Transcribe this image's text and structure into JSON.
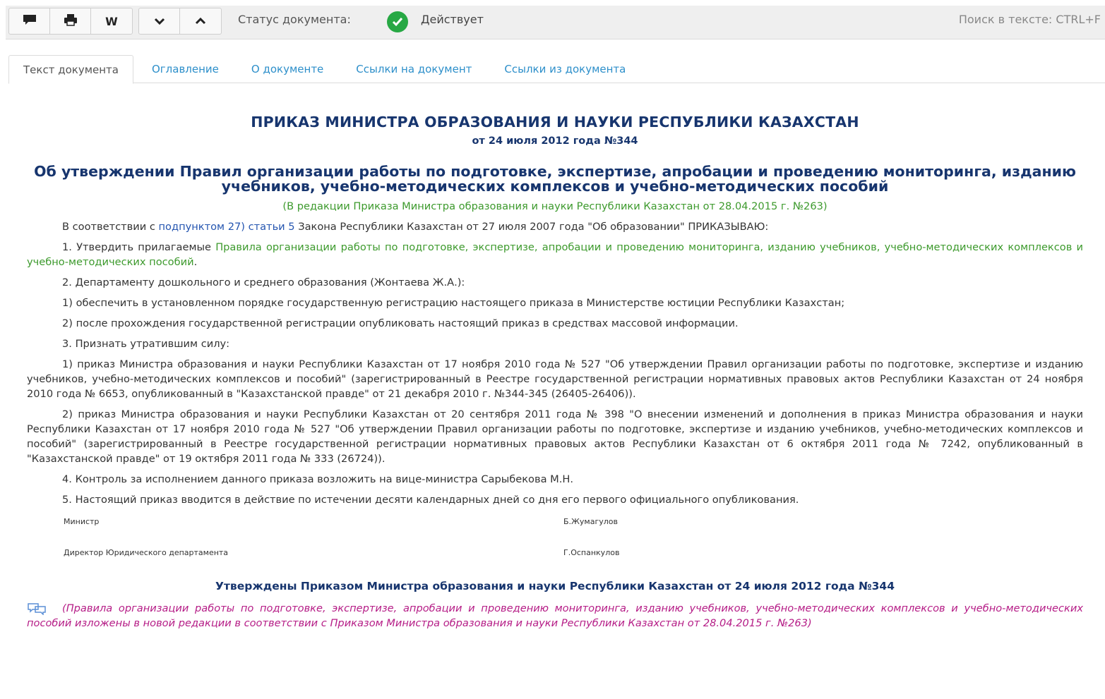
{
  "toolbar": {
    "buttons": [
      {
        "name": "comment-icon"
      },
      {
        "name": "print-icon"
      },
      {
        "name": "word-export",
        "label": "W"
      }
    ],
    "nav": [
      {
        "name": "chevron-down-icon"
      },
      {
        "name": "chevron-up-icon"
      }
    ],
    "status_label": "Статус документа:",
    "status_value": "Действует",
    "search_hint": "Поиск в тексте: CTRL+F",
    "status_color": "#27a844"
  },
  "tabs": [
    {
      "label": "Текст документа",
      "active": true
    },
    {
      "label": "Оглавление"
    },
    {
      "label": "О документе"
    },
    {
      "label": "Ссылки на документ"
    },
    {
      "label": "Ссылки из документа"
    }
  ],
  "doc": {
    "title": "ПРИКАЗ МИНИСТРА ОБРАЗОВАНИЯ И НАУКИ РЕСПУБЛИКИ КАЗАХСТАН",
    "date": "от 24 июля 2012 года №344",
    "subject": "Об утверждении Правил организации работы по подготовке, экспертизе, апробации и проведению мониторинга, изданию учебников, учебно-методических комплексов и учебно-методических пособий",
    "redaction": "(В редакции Приказа Министра образования и науки Республики Казахстан от 28.04.2015 г. №263)",
    "p_intro": {
      "a": "В соответствии с ",
      "link1": "подпунктом 27)",
      "b": " ",
      "link2": "статьи 5",
      "c": " Закона Республики Казахстан от 27 июля 2007 года \"Об образовании\" ПРИКАЗЫВАЮ:"
    },
    "p1": {
      "a": "1. Утвердить прилагаемые ",
      "link": "Правила организации работы по подготовке, экспертизе, апробации и проведению мониторинга, изданию учебников, учебно-методических комплексов и учебно-методических пособий",
      "b": "."
    },
    "p2": "2. Департаменту дошкольного и среднего образования (Жонтаева Ж.А.):",
    "p2_1": "1) обеспечить в установленном порядке государственную регистрацию настоящего приказа в Министерстве юстиции Республики Казахстан;",
    "p2_2": "2) после прохождения государственной регистрации опубликовать настоящий приказ в средствах массовой информации.",
    "p3": "3. Признать утратившим силу:",
    "p3_1": "1) приказ Министра образования и науки Республики Казахстан от 17 ноября 2010 года № 527 \"Об утверждении Правил организации работы по подготовке, экспертизе и изданию учебников, учебно-методических комплексов и пособий\" (зарегистрированный в Реестре государственной регистрации нормативных правовых актов Республики Казахстан от 24 ноября 2010 года № 6653, опубликованный в \"Казахстанской правде\" от 21 декабря 2010 г. №344-345 (26405-26406)).",
    "p3_2": "2) приказ Министра образования и науки Республики Казахстан от 20 сентября 2011 года № 398 \"О внесении изменений и дополнения в приказ Министра образования и науки Республики Казахстан от 17 ноября 2010 года № 527 \"Об утверждении Правил организации работы по подготовке, экспертизе и изданию учебников, учебно-методических комплексов и пособий\" (зарегистрированный в Реестре государственной регистрации нормативных правовых актов Республики Казахстан от 6 октября 2011 года № 7242, опубликованный в \"Казахстанской правде\" от 19 октября 2011 года № 333 (26724)).",
    "p4": "4. Контроль за исполнением данного приказа возложить на вице-министра Сарыбекова М.Н.",
    "p5": "5. Настоящий приказ вводится в действие по истечении десяти календарных дней со дня его первого официального опубликования.",
    "sign1_role": "Министр",
    "sign1_name": "Б.Жумагулов",
    "sign2_role": "Директор Юридического департамента",
    "sign2_name": "Г.Оспанкулов",
    "approved": "Утверждены Приказом Министра образования и науки Республики Казахстан от 24 июля 2012 года №344",
    "note": "(Правила организации работы по подготовке, экспертизе, апробации и проведению мониторинга, изданию учебников, учебно-методических комплексов и учебно-методических пособий изложены в новой редакции в соответствии с Приказом Министра образования и науки Республики Казахстан от 28.04.2015 г. №263)"
  }
}
